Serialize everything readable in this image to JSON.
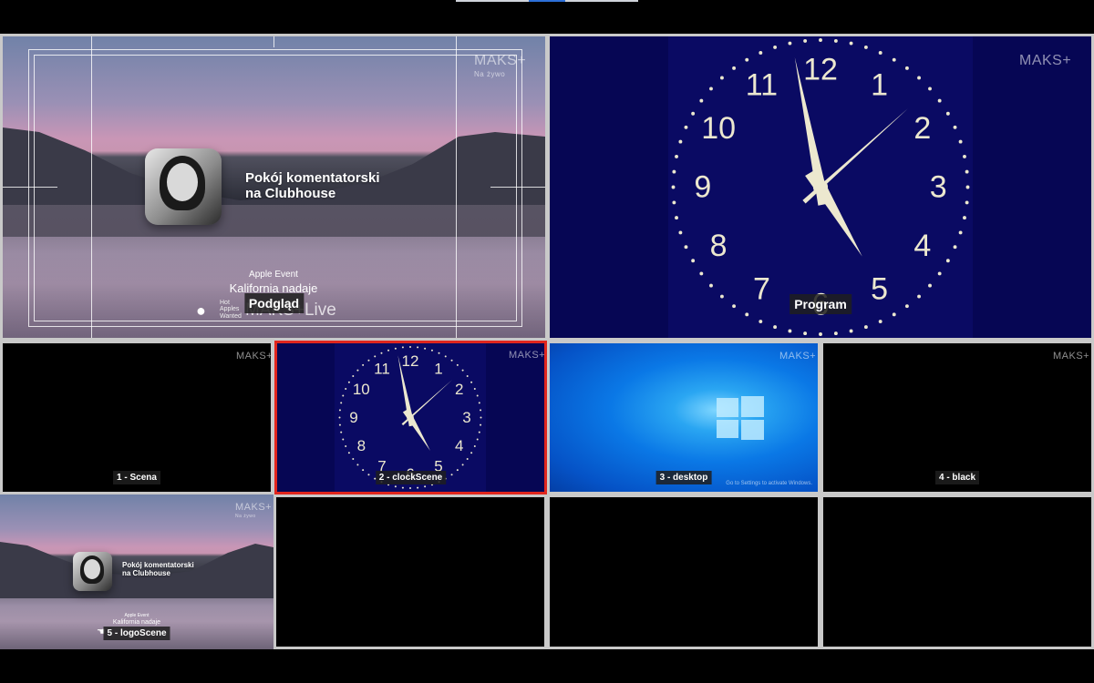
{
  "preview": {
    "label": "Podgląd",
    "logo": "MAKS+",
    "logo_sub": "Na żywo",
    "room_title_line1": "Pokój komentatorski",
    "room_title_line2": "na Clubhouse",
    "event_line1": "Apple Event",
    "event_line2": "Kalifornia nadaje",
    "badge_line1": "Hot",
    "badge_line2": "Apples",
    "badge_line3": "Wanted",
    "brand_live": "MAKS+Live"
  },
  "program": {
    "label": "Program",
    "logo": "MAKS+",
    "clock": {
      "hour": 4,
      "minute": 58,
      "second": 8
    },
    "numbers": [
      "12",
      "1",
      "2",
      "3",
      "4",
      "5",
      "6",
      "7",
      "8",
      "9",
      "10",
      "11"
    ]
  },
  "scenes": [
    {
      "label": "1 - Scena",
      "logo": "MAKS+"
    },
    {
      "label": "2 - clockScene",
      "logo": "MAKS+"
    },
    {
      "label": "3 - desktop",
      "logo": "MAKS+",
      "note": "Go to Settings to activate Windows."
    },
    {
      "label": "4 - black",
      "logo": "MAKS+"
    },
    {
      "label": "5 - logoScene",
      "logo": "MAKS+",
      "logo_sub": "Na żywo",
      "room_title_line1": "Pokój komentatorski",
      "room_title_line2": "na Clubhouse",
      "event_line1": "Apple Event",
      "event_line2": "Kalifornia nadaje"
    }
  ],
  "colors": {
    "selected_red": "#e0261e",
    "selected_green": "#27c21f",
    "clock_bg": "#0a0a63",
    "clock_ink": "#ece8cf"
  }
}
